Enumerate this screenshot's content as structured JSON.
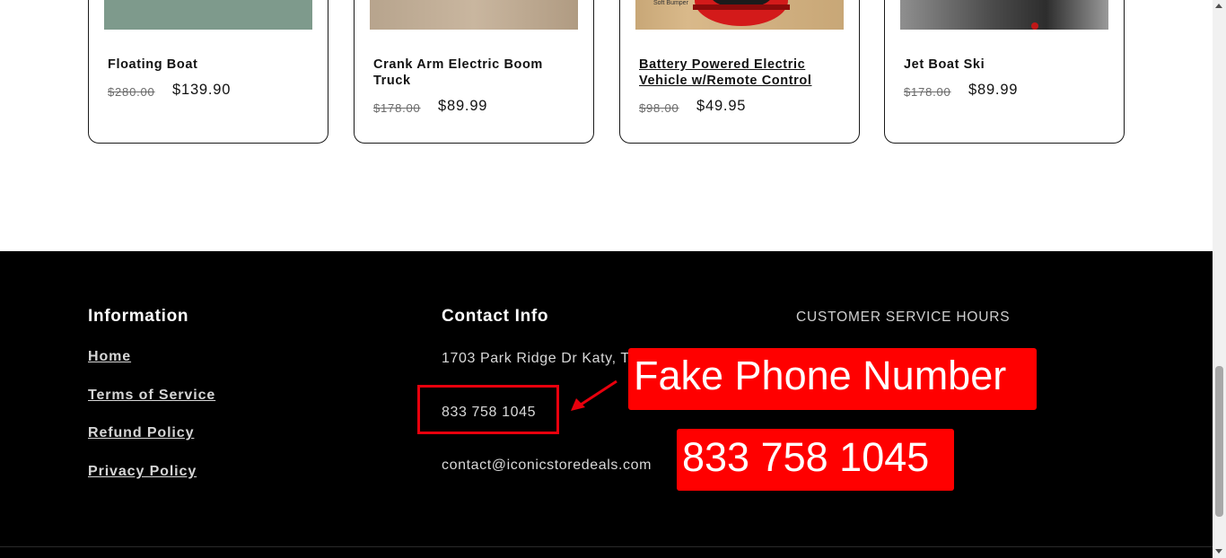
{
  "products": [
    {
      "title": "Floating Boat",
      "old_price": "$280.00",
      "price": "$139.90",
      "image": "floating-boat-photo",
      "hovered": false
    },
    {
      "title": "Crank Arm Electric Boom Truck",
      "old_price": "$178.00",
      "price": "$89.99",
      "image": "boom-truck-photo",
      "hovered": false
    },
    {
      "title": "Battery Powered Electric Vehicle w/Remote Control",
      "old_price": "$98.00",
      "price": "$49.95",
      "image": "bumper-car-photo",
      "image_text": "Soft Bumper",
      "hovered": true
    },
    {
      "title": "Jet Boat Ski",
      "old_price": "$178.00",
      "price": "$89.99",
      "image": "jet-boat-photo",
      "hovered": false
    }
  ],
  "footer": {
    "information": {
      "heading": "Information",
      "links": [
        "Home",
        "Terms of Service",
        "Refund Policy",
        "Privacy Policy"
      ]
    },
    "contact": {
      "heading": "Contact Info",
      "address": "1703 Park Ridge Dr Katy, T",
      "phone": "833 758 1045",
      "email": "contact@iconicstoredeals.com"
    },
    "hours": {
      "heading": "CUSTOMER SERVICE HOURS"
    }
  },
  "annotation": {
    "label": "Fake Phone Number",
    "number": "833 758 1045",
    "color": "#ff0000"
  }
}
